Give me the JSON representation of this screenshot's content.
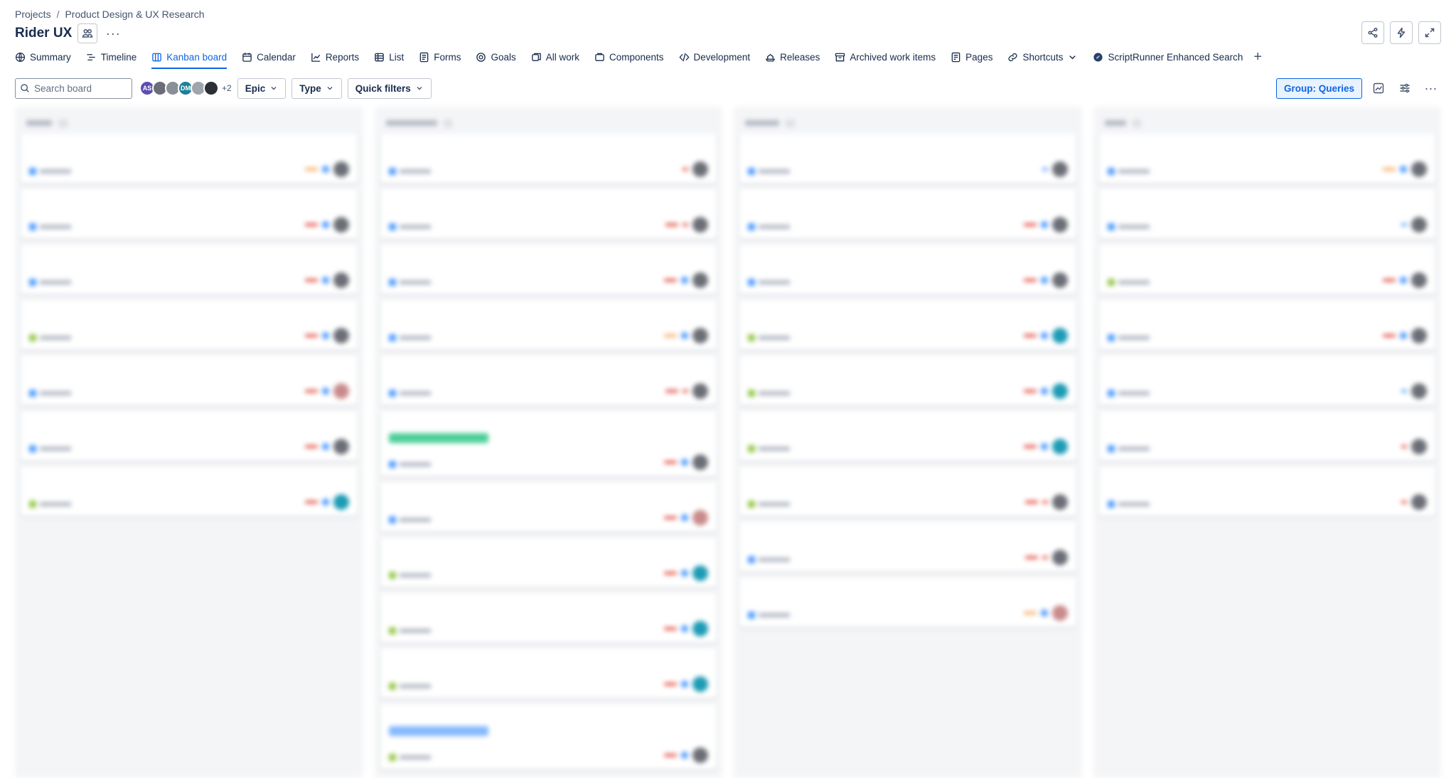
{
  "breadcrumb": {
    "root": "Projects",
    "sep": "/",
    "current": "Product Design & UX Research"
  },
  "page": {
    "title": "Rider UX"
  },
  "tabs": [
    {
      "label": "Summary",
      "icon": "globe-icon"
    },
    {
      "label": "Timeline",
      "icon": "timeline-icon"
    },
    {
      "label": "Kanban board",
      "icon": "board-icon",
      "active": true
    },
    {
      "label": "Calendar",
      "icon": "calendar-icon"
    },
    {
      "label": "Reports",
      "icon": "chart-icon"
    },
    {
      "label": "List",
      "icon": "list-icon"
    },
    {
      "label": "Forms",
      "icon": "forms-icon"
    },
    {
      "label": "Goals",
      "icon": "target-icon"
    },
    {
      "label": "All work",
      "icon": "stack-icon"
    },
    {
      "label": "Components",
      "icon": "component-icon"
    },
    {
      "label": "Development",
      "icon": "code-icon"
    },
    {
      "label": "Releases",
      "icon": "ship-icon"
    },
    {
      "label": "Archived work items",
      "icon": "archive-icon"
    },
    {
      "label": "Pages",
      "icon": "page-icon"
    },
    {
      "label": "Shortcuts",
      "icon": "link-icon"
    },
    {
      "label": "ScriptRunner Enhanced Search",
      "icon": "scriptrunner-icon"
    }
  ],
  "toolbar": {
    "search_placeholder": "Search board",
    "avatars": [
      {
        "initials": "AS",
        "color": "#5e4db2"
      },
      {
        "initials": "",
        "color": "#6b6e76"
      },
      {
        "initials": "",
        "color": "#8a8f98"
      },
      {
        "initials": "DM",
        "color": "#1d7f99"
      },
      {
        "initials": "",
        "color": "#9fa4ad"
      },
      {
        "initials": "",
        "color": "#2c2f36"
      }
    ],
    "avatar_more": "+2",
    "epic": "Epic",
    "type": "Type",
    "quick_filters": "Quick filters",
    "group": "Group: Queries"
  },
  "colors": {
    "accent": "#0c66e4",
    "accent_bg": "#e9f2ff"
  }
}
